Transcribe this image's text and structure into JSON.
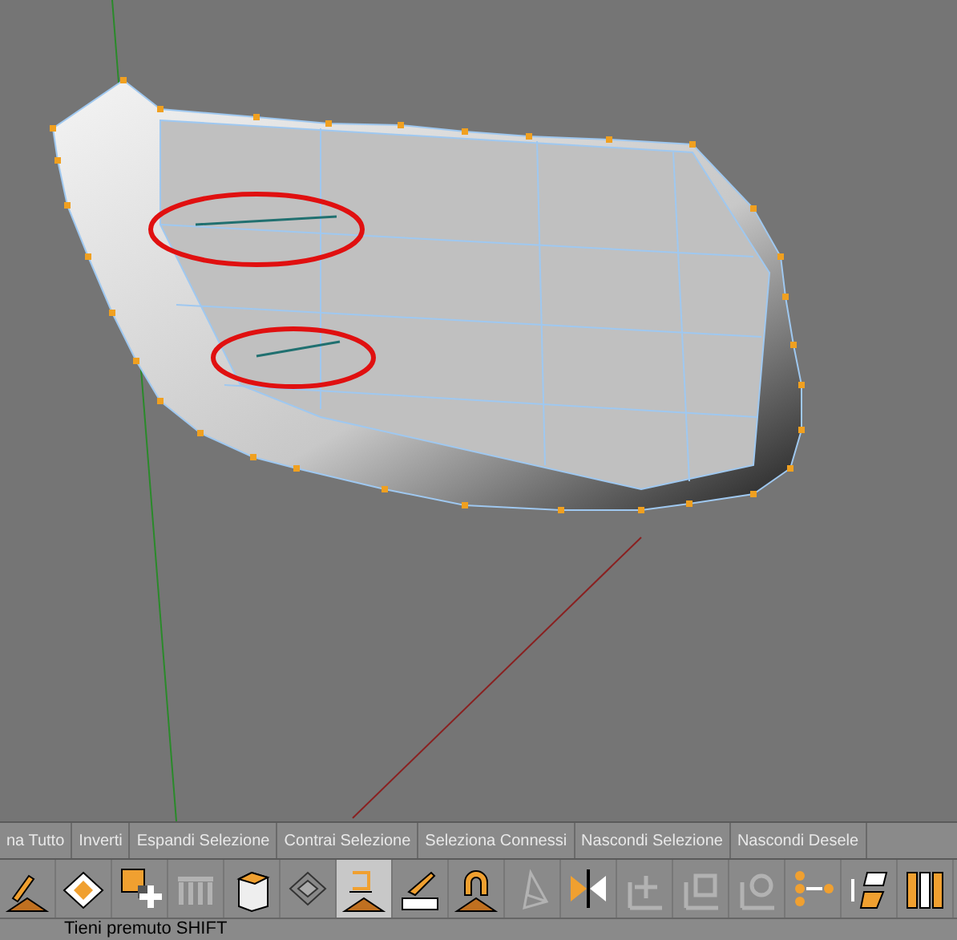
{
  "commands": [
    {
      "label": "na Tutto"
    },
    {
      "label": "Inverti"
    },
    {
      "label": "Espandi Selezione"
    },
    {
      "label": "Contrai Selezione"
    },
    {
      "label": "Seleziona Connessi"
    },
    {
      "label": "Nascondi Selezione"
    },
    {
      "label": "Nascondi Desele"
    }
  ],
  "tools": [
    {
      "selected": false,
      "disabled": false
    },
    {
      "selected": false,
      "disabled": false
    },
    {
      "selected": false,
      "disabled": false
    },
    {
      "selected": false,
      "disabled": true
    },
    {
      "selected": false,
      "disabled": false
    },
    {
      "selected": false,
      "disabled": false
    },
    {
      "selected": true,
      "disabled": false
    },
    {
      "selected": false,
      "disabled": false
    },
    {
      "selected": false,
      "disabled": false
    },
    {
      "selected": false,
      "disabled": true
    },
    {
      "selected": false,
      "disabled": false
    },
    {
      "selected": false,
      "disabled": true
    },
    {
      "selected": false,
      "disabled": true
    },
    {
      "selected": false,
      "disabled": true
    },
    {
      "selected": false,
      "disabled": false
    },
    {
      "selected": false,
      "disabled": false
    },
    {
      "selected": false,
      "disabled": false
    }
  ],
  "status_bar": {
    "text": "Tieni premuto SHIFT"
  }
}
